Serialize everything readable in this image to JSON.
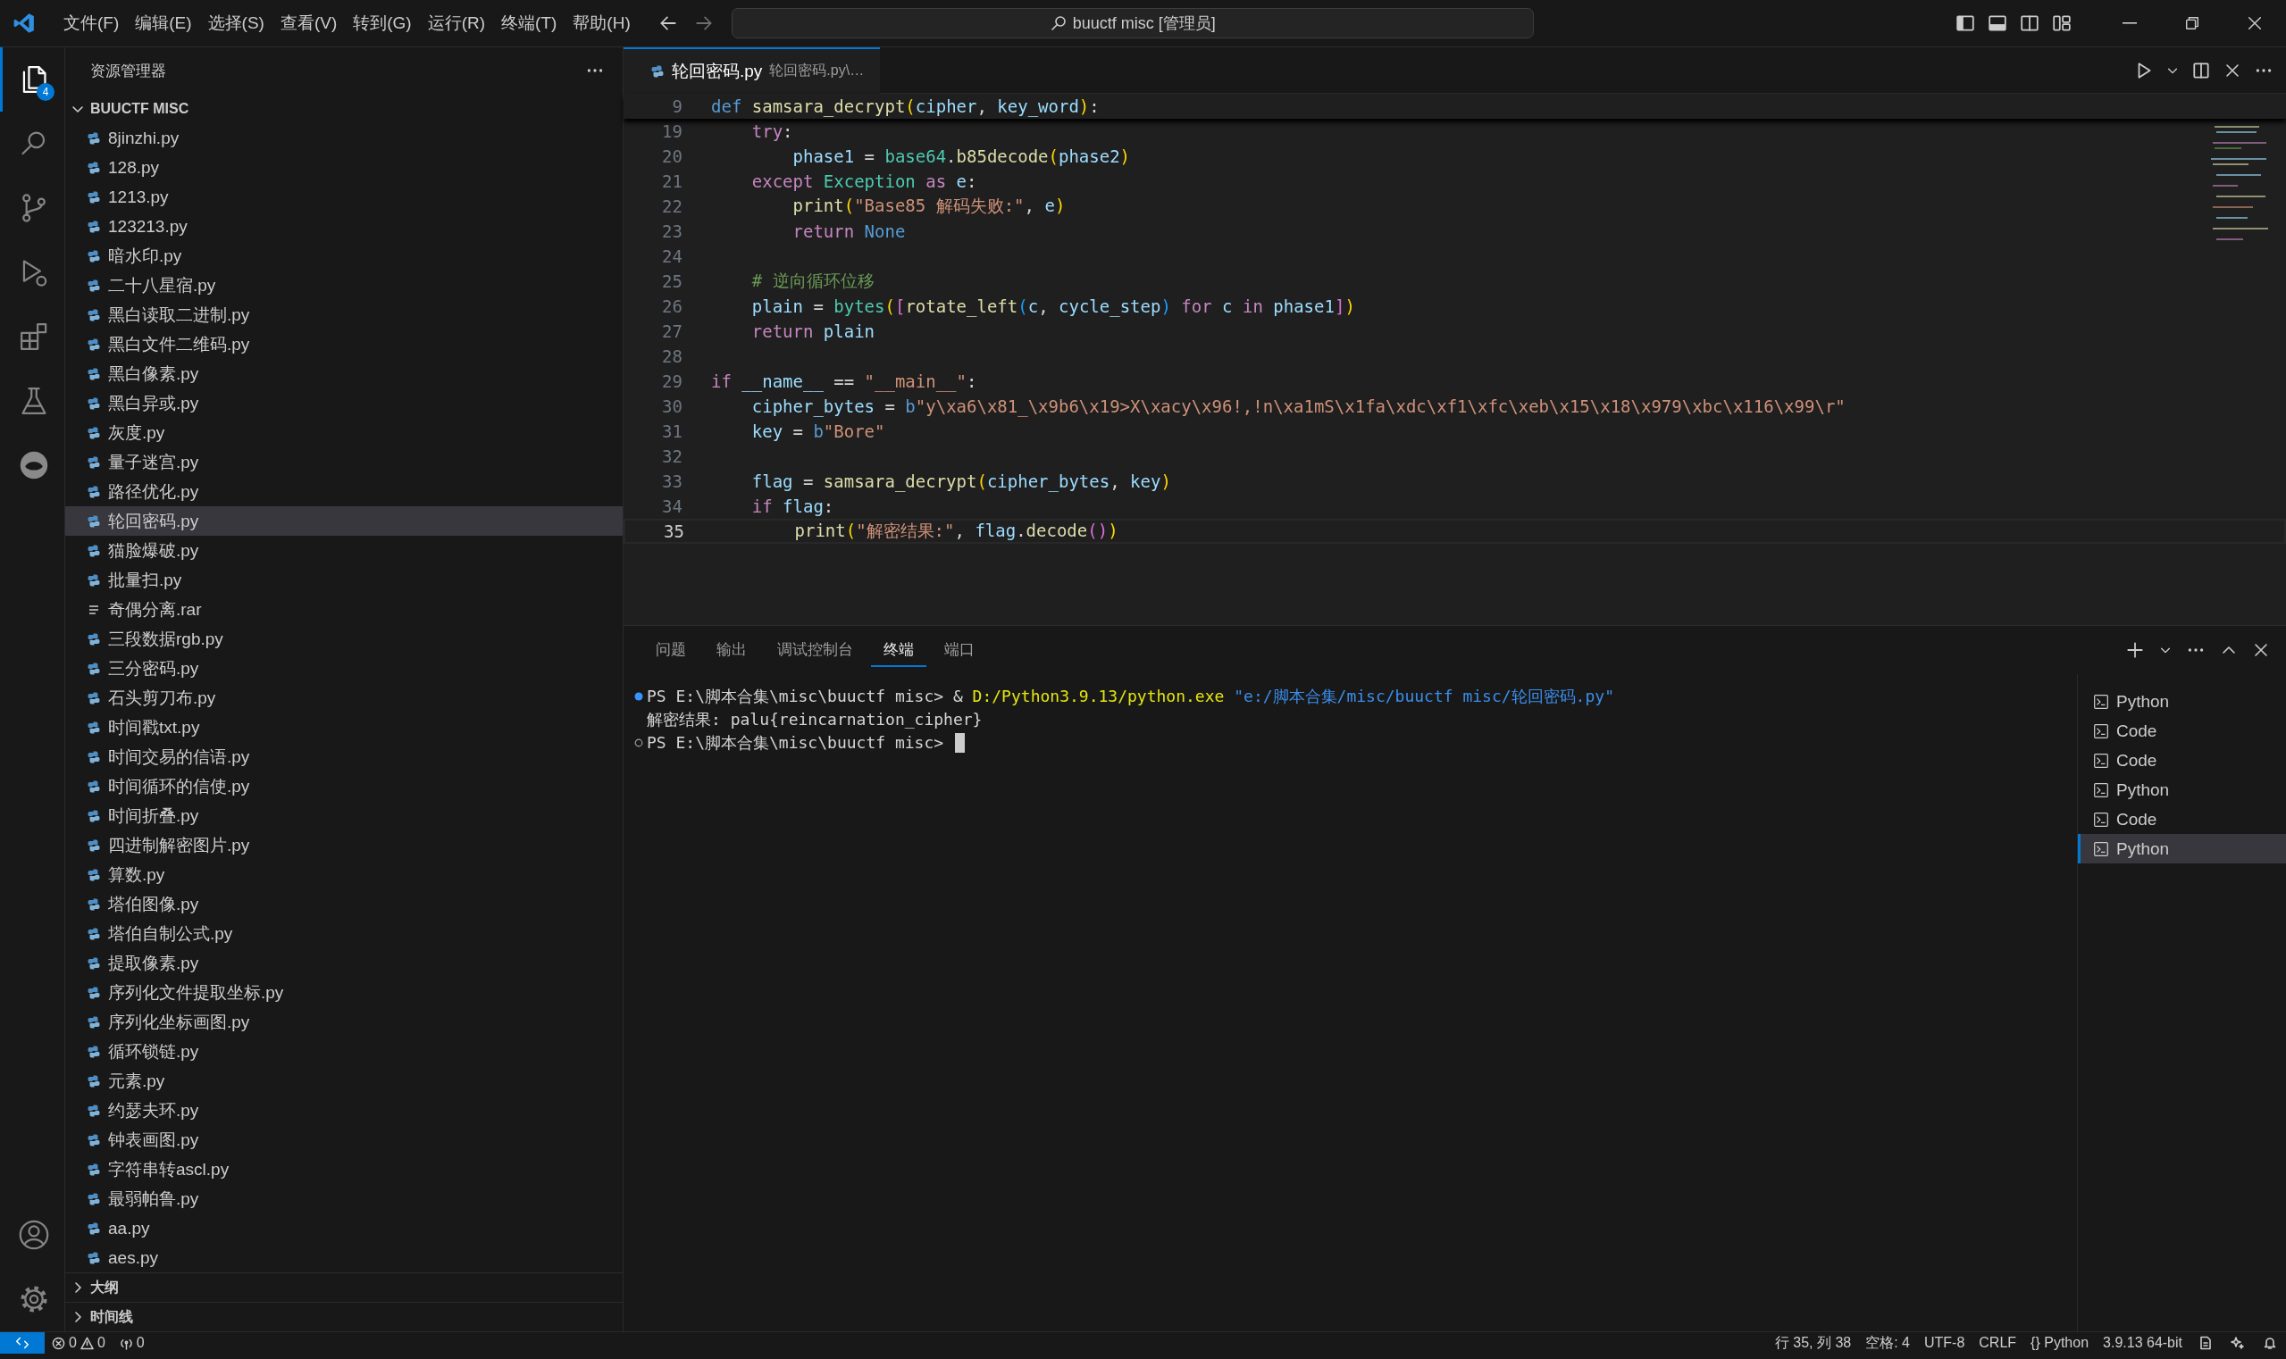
{
  "title_bar": {
    "menus": [
      "文件(F)",
      "编辑(E)",
      "选择(S)",
      "查看(V)",
      "转到(G)",
      "运行(R)",
      "终端(T)",
      "帮助(H)"
    ],
    "command_center": "buuctf misc [管理员]"
  },
  "activity_bar": {
    "items": [
      {
        "kind": "explorer",
        "selected": true,
        "badge": "4"
      },
      {
        "kind": "search",
        "selected": false
      },
      {
        "kind": "source-control",
        "selected": false
      },
      {
        "kind": "run-debug",
        "selected": false
      },
      {
        "kind": "extensions",
        "selected": false
      },
      {
        "kind": "testing",
        "selected": false
      },
      {
        "kind": "circle",
        "selected": false
      }
    ],
    "bottom_items": [
      {
        "kind": "account"
      },
      {
        "kind": "settings"
      }
    ]
  },
  "sidebar": {
    "title": "资源管理器",
    "folder": {
      "name": "BUUCTF MISC",
      "expanded": true,
      "files": [
        {
          "name": "8jinzhi.py",
          "kind": "py",
          "selected": false
        },
        {
          "name": "128.py",
          "kind": "py",
          "selected": false
        },
        {
          "name": "1213.py",
          "kind": "py",
          "selected": false
        },
        {
          "name": "123213.py",
          "kind": "py",
          "selected": false
        },
        {
          "name": "暗水印.py",
          "kind": "py",
          "selected": false
        },
        {
          "name": "二十八星宿.py",
          "kind": "py",
          "selected": false
        },
        {
          "name": "黑白读取二进制.py",
          "kind": "py",
          "selected": false
        },
        {
          "name": "黑白文件二维码.py",
          "kind": "py",
          "selected": false
        },
        {
          "name": "黑白像素.py",
          "kind": "py",
          "selected": false
        },
        {
          "name": "黑白异或.py",
          "kind": "py",
          "selected": false
        },
        {
          "name": "灰度.py",
          "kind": "py",
          "selected": false
        },
        {
          "name": "量子迷宫.py",
          "kind": "py",
          "selected": false
        },
        {
          "name": "路径优化.py",
          "kind": "py",
          "selected": false
        },
        {
          "name": "轮回密码.py",
          "kind": "py",
          "selected": true
        },
        {
          "name": "猫脸爆破.py",
          "kind": "py",
          "selected": false
        },
        {
          "name": "批量扫.py",
          "kind": "py",
          "selected": false
        },
        {
          "name": "奇偶分离.rar",
          "kind": "rar",
          "selected": false
        },
        {
          "name": "三段数据rgb.py",
          "kind": "py",
          "selected": false
        },
        {
          "name": "三分密码.py",
          "kind": "py",
          "selected": false
        },
        {
          "name": "石头剪刀布.py",
          "kind": "py",
          "selected": false
        },
        {
          "name": "时间戳txt.py",
          "kind": "py",
          "selected": false
        },
        {
          "name": "时间交易的信语.py",
          "kind": "py",
          "selected": false
        },
        {
          "name": "时间循环的信使.py",
          "kind": "py",
          "selected": false
        },
        {
          "name": "时间折叠.py",
          "kind": "py",
          "selected": false
        },
        {
          "name": "四进制解密图片.py",
          "kind": "py",
          "selected": false
        },
        {
          "name": "算数.py",
          "kind": "py",
          "selected": false
        },
        {
          "name": "塔伯图像.py",
          "kind": "py",
          "selected": false
        },
        {
          "name": "塔伯自制公式.py",
          "kind": "py",
          "selected": false
        },
        {
          "name": "提取像素.py",
          "kind": "py",
          "selected": false
        },
        {
          "name": "序列化文件提取坐标.py",
          "kind": "py",
          "selected": false
        },
        {
          "name": "序列化坐标画图.py",
          "kind": "py",
          "selected": false
        },
        {
          "name": "循环锁链.py",
          "kind": "py",
          "selected": false
        },
        {
          "name": "元素.py",
          "kind": "py",
          "selected": false
        },
        {
          "name": "约瑟夫环.py",
          "kind": "py",
          "selected": false
        },
        {
          "name": "钟表画图.py",
          "kind": "py",
          "selected": false
        },
        {
          "name": "字符串转ascl.py",
          "kind": "py",
          "selected": false
        },
        {
          "name": "最弱帕鲁.py",
          "kind": "py",
          "selected": false
        },
        {
          "name": "aa.py",
          "kind": "py",
          "selected": false
        },
        {
          "name": "aes.py",
          "kind": "py",
          "selected": false
        }
      ]
    },
    "sections": [
      {
        "name": "大纲",
        "expanded": false
      },
      {
        "name": "时间线",
        "expanded": false
      }
    ]
  },
  "editor": {
    "tab": {
      "label": "轮回密码.py",
      "description": "轮回密码.py\\…"
    },
    "sticky": {
      "number": "9",
      "tokens": [
        {
          "kind": "storage",
          "text": "def "
        },
        {
          "kind": "function",
          "text": "samsara_decrypt"
        },
        {
          "kind": "bracket1",
          "text": "("
        },
        {
          "kind": "variable",
          "text": "cipher"
        },
        {
          "kind": "plain",
          "text": ", "
        },
        {
          "kind": "variable",
          "text": "key_word"
        },
        {
          "kind": "bracket1",
          "text": ")"
        },
        {
          "kind": "plain",
          "text": ":"
        }
      ]
    },
    "lines": [
      {
        "number": "19",
        "current": false,
        "tokens": [
          {
            "kind": "keyword",
            "text": "    try"
          },
          {
            "kind": "plain",
            "text": ":"
          }
        ]
      },
      {
        "number": "20",
        "current": false,
        "tokens": [
          {
            "kind": "variable",
            "text": "        phase1"
          },
          {
            "kind": "plain",
            "text": " = "
          },
          {
            "kind": "class",
            "text": "base64"
          },
          {
            "kind": "plain",
            "text": "."
          },
          {
            "kind": "function",
            "text": "b85decode"
          },
          {
            "kind": "bracket1",
            "text": "("
          },
          {
            "kind": "variable",
            "text": "phase2"
          },
          {
            "kind": "bracket1",
            "text": ")"
          }
        ]
      },
      {
        "number": "21",
        "current": false,
        "tokens": [
          {
            "kind": "keyword",
            "text": "    except "
          },
          {
            "kind": "class",
            "text": "Exception "
          },
          {
            "kind": "keyword",
            "text": "as "
          },
          {
            "kind": "variable",
            "text": "e"
          },
          {
            "kind": "plain",
            "text": ":"
          }
        ]
      },
      {
        "number": "22",
        "current": false,
        "tokens": [
          {
            "kind": "function",
            "text": "        print"
          },
          {
            "kind": "bracket1",
            "text": "("
          },
          {
            "kind": "string",
            "text": "\"Base85 解码失败:\""
          },
          {
            "kind": "plain",
            "text": ", "
          },
          {
            "kind": "variable",
            "text": "e"
          },
          {
            "kind": "bracket1",
            "text": ")"
          }
        ]
      },
      {
        "number": "23",
        "current": false,
        "tokens": [
          {
            "kind": "keyword",
            "text": "        return "
          },
          {
            "kind": "storage",
            "text": "None"
          }
        ]
      },
      {
        "number": "24",
        "current": false
      },
      {
        "number": "25",
        "current": false,
        "tokens": [
          {
            "kind": "comment",
            "text": "    # 逆向循环位移"
          }
        ]
      },
      {
        "number": "26",
        "current": false,
        "tokens": [
          {
            "kind": "variable",
            "text": "    plain"
          },
          {
            "kind": "plain",
            "text": " = "
          },
          {
            "kind": "class",
            "text": "bytes"
          },
          {
            "kind": "bracket1",
            "text": "("
          },
          {
            "kind": "bracket2",
            "text": "["
          },
          {
            "kind": "function",
            "text": "rotate_left"
          },
          {
            "kind": "bracket3",
            "text": "("
          },
          {
            "kind": "variable",
            "text": "c"
          },
          {
            "kind": "plain",
            "text": ", "
          },
          {
            "kind": "variable",
            "text": "cycle_step"
          },
          {
            "kind": "bracket3",
            "text": ")"
          },
          {
            "kind": "keyword",
            "text": " for "
          },
          {
            "kind": "variable",
            "text": "c"
          },
          {
            "kind": "keyword",
            "text": " in "
          },
          {
            "kind": "variable",
            "text": "phase1"
          },
          {
            "kind": "bracket2",
            "text": "]"
          },
          {
            "kind": "bracket1",
            "text": ")"
          }
        ]
      },
      {
        "number": "27",
        "current": false,
        "tokens": [
          {
            "kind": "keyword",
            "text": "    return "
          },
          {
            "kind": "variable",
            "text": "plain"
          }
        ]
      },
      {
        "number": "28",
        "current": false
      },
      {
        "number": "29",
        "current": false,
        "tokens": [
          {
            "kind": "keyword",
            "text": "if "
          },
          {
            "kind": "variable",
            "text": "__name__"
          },
          {
            "kind": "plain",
            "text": " == "
          },
          {
            "kind": "string",
            "text": "\"__main__\""
          },
          {
            "kind": "plain",
            "text": ":"
          }
        ]
      },
      {
        "number": "30",
        "current": false,
        "tokens": [
          {
            "kind": "variable",
            "text": "    cipher_bytes"
          },
          {
            "kind": "plain",
            "text": " = "
          },
          {
            "kind": "storage",
            "text": "b"
          },
          {
            "kind": "string",
            "text": "\"y\\xa6\\x81_\\x9b6\\x19>X\\xacy\\x96!,!n\\xa1mS\\x1fa\\xdc\\xf1\\xfc\\xeb\\x15\\x18\\x979\\xbc\\x116\\x99\\r\""
          }
        ]
      },
      {
        "number": "31",
        "current": false,
        "tokens": [
          {
            "kind": "variable",
            "text": "    key"
          },
          {
            "kind": "plain",
            "text": " = "
          },
          {
            "kind": "storage",
            "text": "b"
          },
          {
            "kind": "string",
            "text": "\"Bore\""
          }
        ]
      },
      {
        "number": "32",
        "current": false
      },
      {
        "number": "33",
        "current": false,
        "tokens": [
          {
            "kind": "variable",
            "text": "    flag"
          },
          {
            "kind": "plain",
            "text": " = "
          },
          {
            "kind": "function",
            "text": "samsara_decrypt"
          },
          {
            "kind": "bracket1",
            "text": "("
          },
          {
            "kind": "variable",
            "text": "cipher_bytes"
          },
          {
            "kind": "plain",
            "text": ", "
          },
          {
            "kind": "variable",
            "text": "key"
          },
          {
            "kind": "bracket1",
            "text": ")"
          }
        ]
      },
      {
        "number": "34",
        "current": false,
        "tokens": [
          {
            "kind": "keyword",
            "text": "    if "
          },
          {
            "kind": "variable",
            "text": "flag"
          },
          {
            "kind": "plain",
            "text": ":"
          }
        ]
      },
      {
        "number": "35",
        "current": true,
        "tokens": [
          {
            "kind": "function",
            "text": "        print"
          },
          {
            "kind": "bracket1",
            "text": "("
          },
          {
            "kind": "string",
            "text": "\"解密结果:\""
          },
          {
            "kind": "plain",
            "text": ", "
          },
          {
            "kind": "variable",
            "text": "flag"
          },
          {
            "kind": "plain",
            "text": "."
          },
          {
            "kind": "function",
            "text": "decode"
          },
          {
            "kind": "bracket2",
            "text": "()"
          },
          {
            "kind": "bracket1",
            "text": ")"
          }
        ]
      }
    ]
  },
  "panel": {
    "tabs": [
      {
        "label": "问题",
        "selected": false
      },
      {
        "label": "输出",
        "selected": false
      },
      {
        "label": "调试控制台",
        "selected": false
      },
      {
        "label": "终端",
        "selected": true
      },
      {
        "label": "端口",
        "selected": false
      }
    ],
    "terminal_lines": [
      {
        "kind": "command-done",
        "cursor": false,
        "tokens": [
          {
            "kind": "plain",
            "text": "PS E:\\脚本合集\\misc\\buuctf misc> & "
          },
          {
            "kind": "command",
            "text": "D:/Python3.9.13/python.exe"
          },
          {
            "kind": "path",
            "text": " \"e:/脚本合集/misc/buuctf misc/轮回密码.py\""
          }
        ]
      },
      {
        "kind": "output",
        "cursor": false,
        "tokens": [
          {
            "kind": "plain",
            "text": "解密结果: palu{reincarnation_cipher}"
          }
        ]
      },
      {
        "kind": "prompt",
        "cursor": true,
        "tokens": [
          {
            "kind": "plain",
            "text": "PS E:\\脚本合集\\misc\\buuctf misc> "
          }
        ]
      }
    ],
    "terminals": [
      {
        "name": "Python",
        "selected": false
      },
      {
        "name": "Code",
        "selected": false
      },
      {
        "name": "Code",
        "selected": false
      },
      {
        "name": "Python",
        "selected": false
      },
      {
        "name": "Code",
        "selected": false
      },
      {
        "name": "Python",
        "selected": true
      }
    ]
  },
  "status_bar": {
    "errors": "0",
    "warnings": "0",
    "ports": "0",
    "items": [
      "行 35, 列 38",
      "空格: 4",
      "UTF-8",
      "CRLF",
      "{} Python",
      "3.9.13 64-bit"
    ]
  }
}
